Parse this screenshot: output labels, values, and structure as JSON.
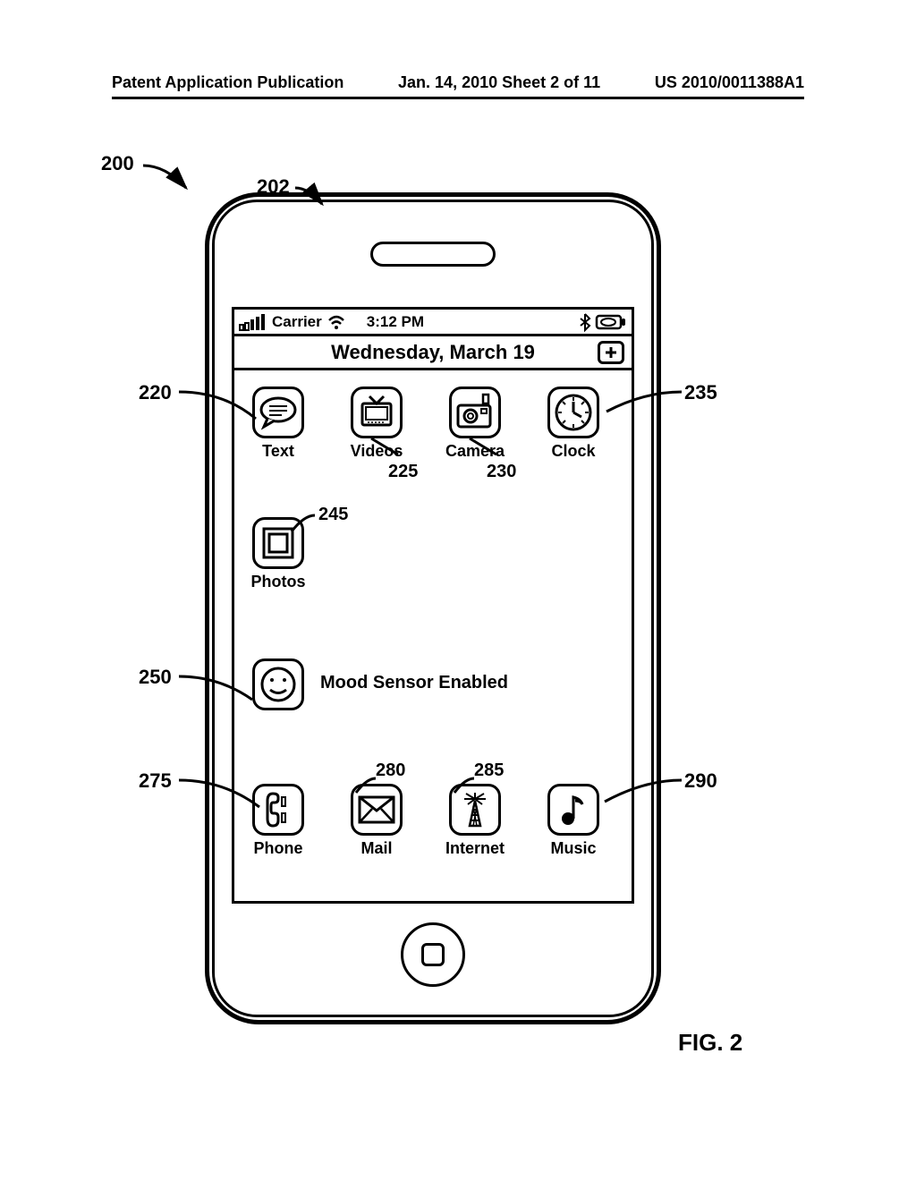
{
  "header": {
    "left": "Patent Application Publication",
    "mid": "Jan. 14, 2010  Sheet 2 of 11",
    "right": "US 2010/0011388A1"
  },
  "status": {
    "carrier": "Carrier",
    "time": "3:12 PM"
  },
  "date_row": "Wednesday, March 19",
  "apps": {
    "text": "Text",
    "videos": "Videos",
    "camera": "Camera",
    "clock": "Clock",
    "photos": "Photos",
    "mood": "Mood Sensor Enabled",
    "phone": "Phone",
    "mail": "Mail",
    "internet": "Internet",
    "music": "Music"
  },
  "refs": {
    "r200": "200",
    "r202": "202",
    "r220": "220",
    "r225": "225",
    "r230": "230",
    "r235": "235",
    "r245": "245",
    "r250": "250",
    "r275": "275",
    "r280": "280",
    "r285": "285",
    "r290": "290"
  },
  "fig": "FIG. 2"
}
